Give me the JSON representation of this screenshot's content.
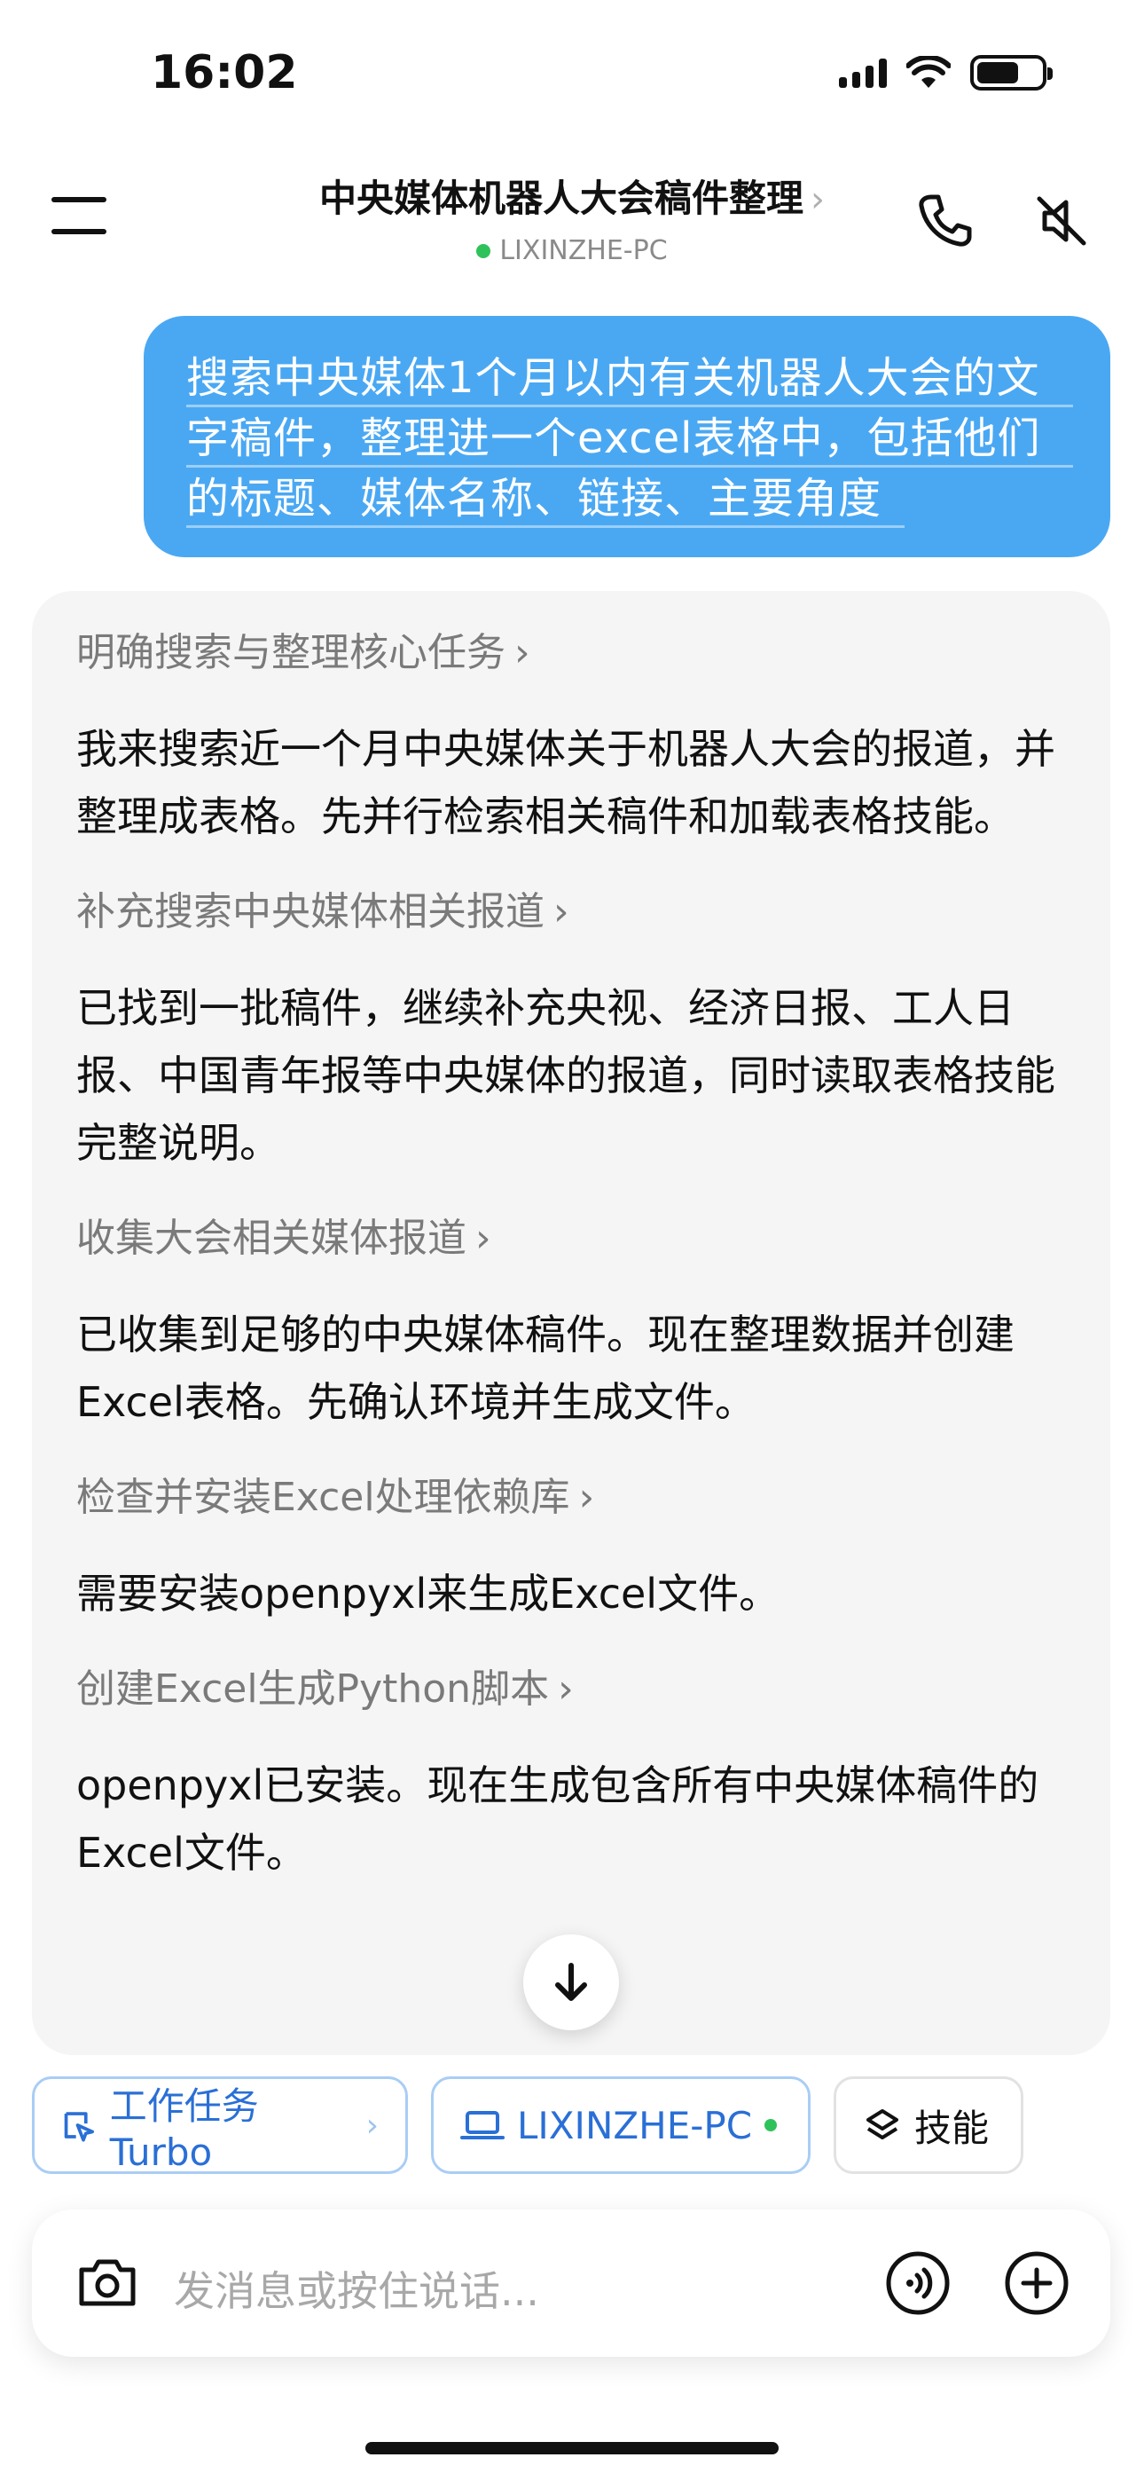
{
  "status_bar": {
    "time": "16:02"
  },
  "header": {
    "title": "中央媒体机器人大会稿件整理",
    "title_chevron": "›",
    "device": "LIXINZHE-PC",
    "device_status_color": "#2fc25b"
  },
  "user_message": {
    "lines": [
      "搜索中央媒体1个月以内有关机器人大会的文",
      "字稿件，整理进一个excel表格中，包括他们",
      "的标题、媒体名称、链接、主要角度"
    ],
    "bubble_color": "#4aa8f3"
  },
  "assistant": {
    "steps": [
      {
        "title": "明确搜索与整理核心任务",
        "body": "我来搜索近一个月中央媒体关于机器人大会的报道，并整理成表格。先并行检索相关稿件和加载表格技能。"
      },
      {
        "title": "补充搜索中央媒体相关报道",
        "body": "已找到一批稿件，继续补充央视、经济日报、工人日报、中国青年报等中央媒体的报道，同时读取表格技能完整说明。"
      },
      {
        "title": "收集大会相关媒体报道",
        "body": "已收集到足够的中央媒体稿件。现在整理数据并创建Excel表格。先确认环境并生成文件。"
      },
      {
        "title": "检查并安装Excel处理依赖库",
        "body": "需要安装openpyxl来生成Excel文件。"
      },
      {
        "title": "创建Excel生成Python脚本",
        "body": "openpyxl已安装。现在生成包含所有中央媒体稿件的Excel文件。"
      }
    ],
    "step_chevron": "›"
  },
  "chips": {
    "task_mode": "工作任务 Turbo",
    "task_mode_chevron": "›",
    "device": "LIXINZHE-PC",
    "skills": "技能"
  },
  "input": {
    "placeholder": "发消息或按住说话..."
  },
  "icons": {
    "menu": "menu-icon",
    "call": "phone-icon",
    "mute": "speaker-mute-icon",
    "scroll": "arrow-down-icon",
    "camera": "camera-icon",
    "voice": "voice-icon",
    "plus": "plus-icon",
    "laptop": "laptop-icon",
    "skills": "layers-icon",
    "task": "task-icon"
  }
}
